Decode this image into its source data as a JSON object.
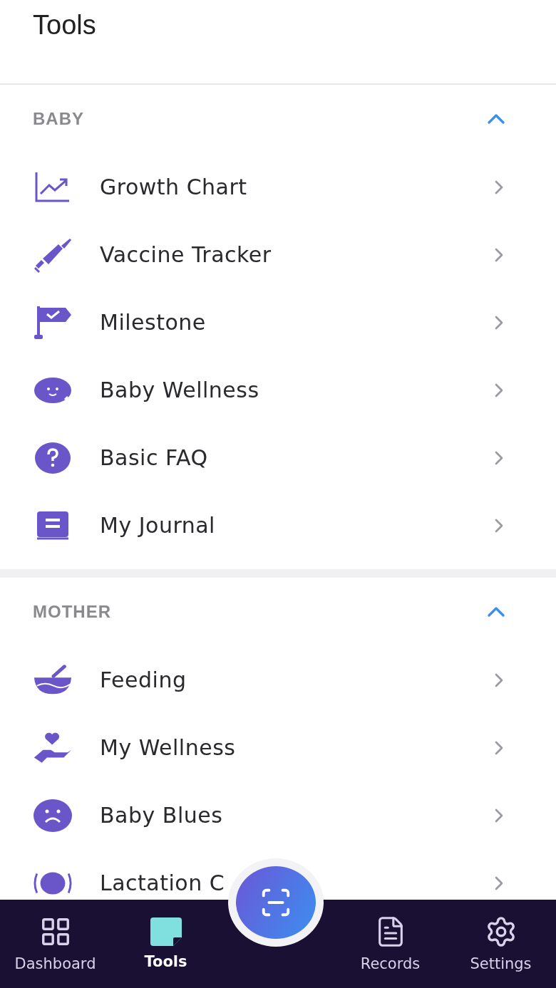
{
  "header": {
    "title": "Tools"
  },
  "sections": [
    {
      "title": "BABY",
      "expanded": true,
      "items": [
        {
          "label": "Growth Chart"
        },
        {
          "label": "Vaccine Tracker"
        },
        {
          "label": "Milestone"
        },
        {
          "label": "Baby Wellness"
        },
        {
          "label": "Basic FAQ"
        },
        {
          "label": "My Journal"
        }
      ]
    },
    {
      "title": "MOTHER",
      "expanded": true,
      "items": [
        {
          "label": "Feeding"
        },
        {
          "label": "My Wellness"
        },
        {
          "label": "Baby Blues"
        },
        {
          "label": "Lactation C"
        }
      ]
    }
  ],
  "nav": [
    {
      "label": "Dashboard",
      "selected": false
    },
    {
      "label": "Tools",
      "selected": true
    },
    {
      "label": "Records",
      "selected": false
    },
    {
      "label": "Settings",
      "selected": false
    }
  ]
}
